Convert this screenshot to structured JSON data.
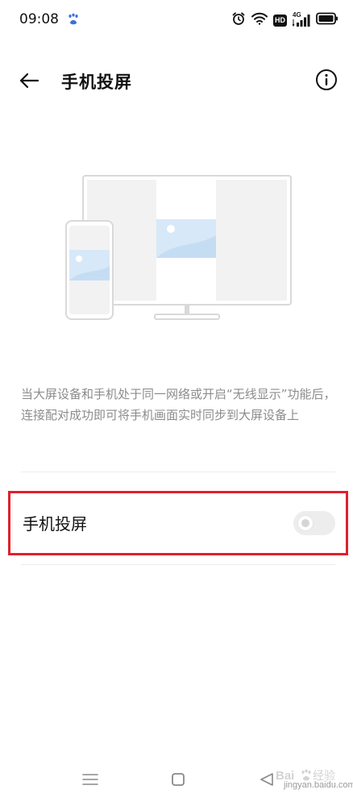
{
  "status_bar": {
    "time": "09:08",
    "icons": [
      "baidu-paw-icon",
      "alarm-icon",
      "wifi-icon",
      "hd-icon",
      "4g-signal-icon",
      "battery-icon"
    ],
    "hd_label": "HD",
    "network_label": "4G"
  },
  "header": {
    "back_icon": "arrow-left-icon",
    "title": "手机投屏",
    "info_icon": "info-icon"
  },
  "illustration": {
    "icon": "phone-to-tv-cast-illustration"
  },
  "description": "当大屏设备和手机处于同一网络或开启“无线显示”功能后，连接配对成功即可将手机画面实时同步到大屏设备上",
  "setting": {
    "label": "手机投屏",
    "enabled": false,
    "highlight_color": "#e0202e"
  },
  "nav_bar": {
    "icons": [
      "menu-icon",
      "home-square-icon",
      "back-triangle-icon"
    ]
  },
  "watermark": {
    "text": "jingyan.baidu.com"
  },
  "colors": {
    "background": "#ffffff",
    "text_primary": "#111111",
    "text_secondary": "#8c8c8c",
    "illustration_accent": "#d7e8f8"
  }
}
